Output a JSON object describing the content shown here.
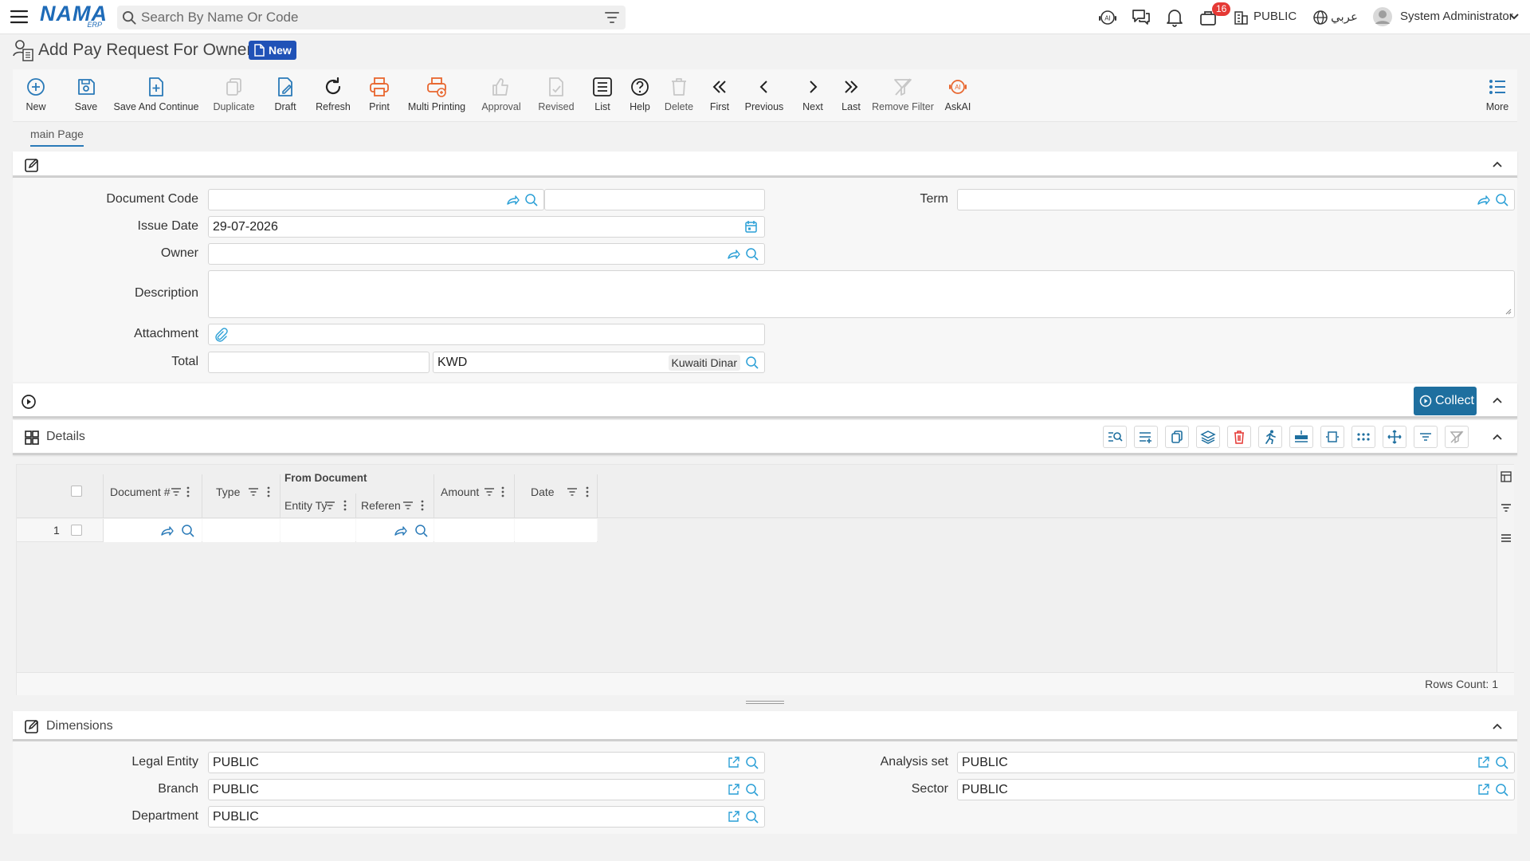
{
  "topbar": {
    "search_placeholder": "Search By Name Or Code",
    "notification_count": "16",
    "branch_label": "PUBLIC",
    "language_label": "عربي",
    "user_name": "System Administrator"
  },
  "logo": {
    "main": "NAMA",
    "sub": "ERP"
  },
  "page": {
    "title": "Add Pay Request For Owner",
    "status_badge": "New"
  },
  "toolbar": {
    "new": "New",
    "save": "Save",
    "save_continue": "Save And Continue",
    "duplicate": "Duplicate",
    "draft": "Draft",
    "refresh": "Refresh",
    "print": "Print",
    "multi_printing": "Multi Printing",
    "approval": "Approval",
    "revised": "Revised",
    "list": "List",
    "help": "Help",
    "delete": "Delete",
    "first": "First",
    "previous": "Previous",
    "next": "Next",
    "last": "Last",
    "remove_filter": "Remove Filter",
    "askai": "AskAI",
    "more": "More"
  },
  "tabs": {
    "main": "main Page"
  },
  "form": {
    "document_code_label": "Document Code",
    "term_label": "Term",
    "issue_date_label": "Issue Date",
    "issue_date_value": "29-07-2026",
    "owner_label": "Owner",
    "description_label": "Description",
    "attachment_label": "Attachment",
    "total_label": "Total",
    "currency_code": "KWD",
    "currency_name": "Kuwaiti Dinar"
  },
  "collect_button": "Collect",
  "details": {
    "title": "Details",
    "columns": {
      "document_no": "Document #",
      "type": "Type",
      "from_document": "From Document",
      "entity_type": "Entity Ty",
      "reference": "Referen",
      "amount": "Amount",
      "date": "Date"
    },
    "rows": [
      {
        "index": "1"
      }
    ],
    "rows_count": "Rows Count: 1"
  },
  "dimensions": {
    "title": "Dimensions",
    "legal_entity_label": "Legal Entity",
    "legal_entity_value": "PUBLIC",
    "analysis_set_label": "Analysis set",
    "analysis_set_value": "PUBLIC",
    "branch_label": "Branch",
    "branch_value": "PUBLIC",
    "sector_label": "Sector",
    "sector_value": "PUBLIC",
    "department_label": "Department",
    "department_value": "PUBLIC"
  },
  "colors": {
    "accent": "#2a7ab8",
    "badge_blue": "#2052b7",
    "collect": "#1e6f9f",
    "print_orange": "#e8662e"
  }
}
